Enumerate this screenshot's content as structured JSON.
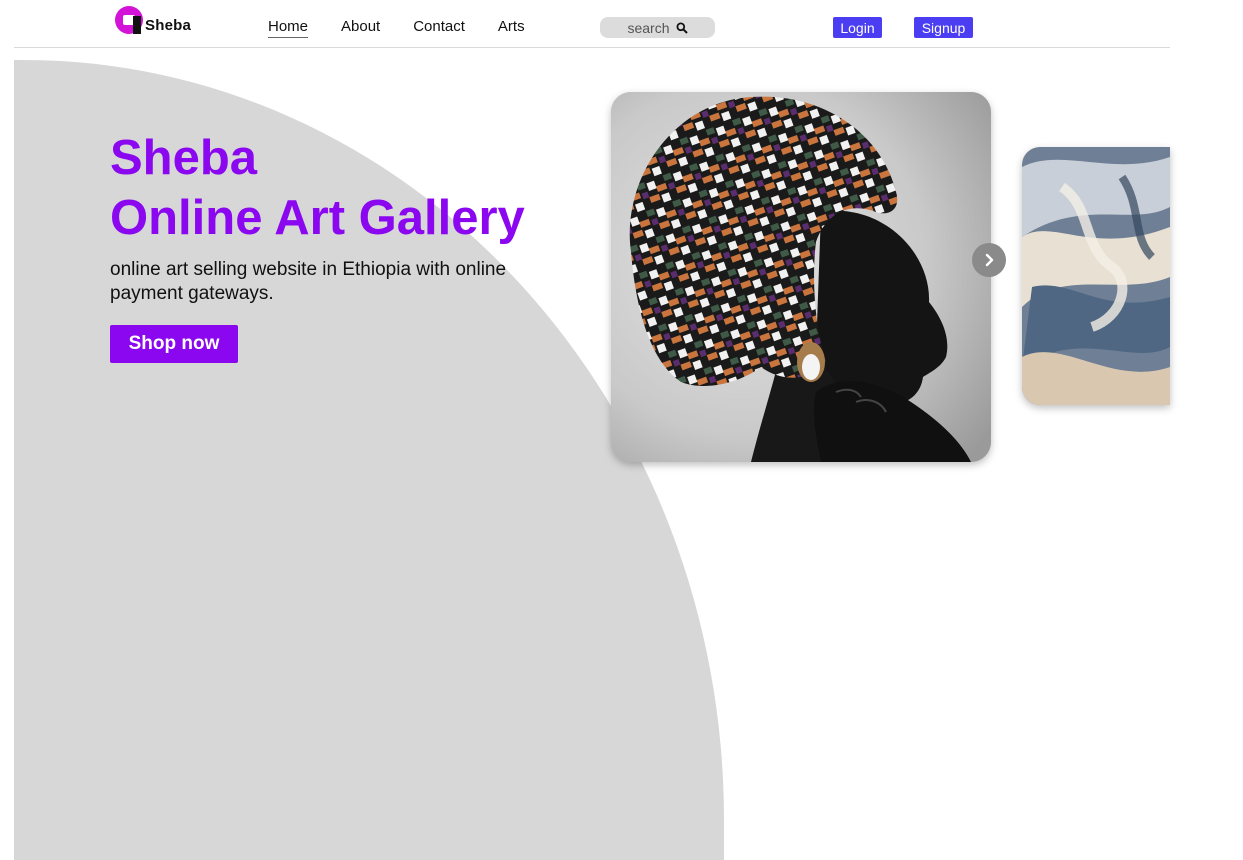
{
  "brand": {
    "name": "Sheba",
    "logo_icon": "sheba-logo-icon",
    "color": "#d413d8"
  },
  "nav": {
    "links": [
      {
        "label": "Home",
        "active": true
      },
      {
        "label": "About",
        "active": false
      },
      {
        "label": "Contact",
        "active": false
      },
      {
        "label": "Arts",
        "active": false
      }
    ],
    "search": {
      "placeholder": "search",
      "icon": "search-icon"
    },
    "login_label": "Login",
    "signup_label": "Signup",
    "auth_button_color": "#4b3df2"
  },
  "hero": {
    "title_line1": "Sheba",
    "title_line2": "Online Art Gallery",
    "description": "online art selling website in Ethiopia with online payment gateways.",
    "cta_label": "Shop now",
    "accent_color": "#8a07f0",
    "background_shape_color": "#d7d7d7"
  },
  "carousel": {
    "slides": [
      {
        "image": "portrait-woman-headwrap-photo"
      },
      {
        "image": "abstract-swirl-painting"
      }
    ],
    "next_icon": "chevron-right-icon"
  }
}
